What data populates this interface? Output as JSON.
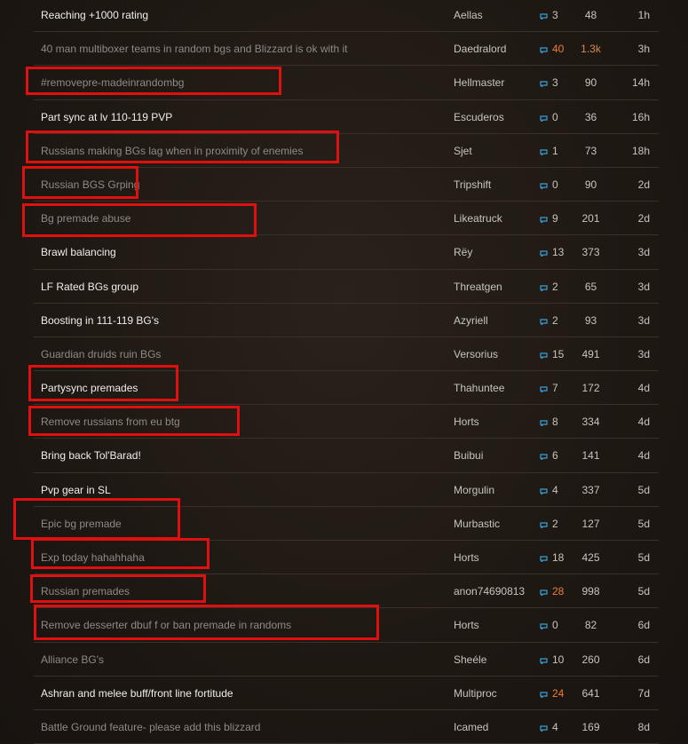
{
  "accent_colors": {
    "reply_icon": "#3aa0d8",
    "hot_count": "#ee7d32",
    "highlight": "#e01010"
  },
  "reply_icon_name": "comment-bubble-icon",
  "topics": [
    {
      "title": "Reaching +1000 rating",
      "author": "Aellas",
      "replies": "3",
      "views": "48",
      "age": "1h",
      "visited": false,
      "hot": false
    },
    {
      "title": "40 man multiboxer teams in random bgs and Blizzard is ok with it",
      "author": "Daedralord",
      "replies": "40",
      "views": "1.3k",
      "age": "3h",
      "visited": true,
      "hot": true
    },
    {
      "title": "#removepre-madeinrandombg",
      "author": "Hellmaster",
      "replies": "3",
      "views": "90",
      "age": "14h",
      "visited": true,
      "hot": false
    },
    {
      "title": "Part sync at lv 110-119 PVP",
      "author": "Escuderos",
      "replies": "0",
      "views": "36",
      "age": "16h",
      "visited": false,
      "hot": false
    },
    {
      "title": "Russians making BGs lag when in proximity of enemies",
      "author": "Sjet",
      "replies": "1",
      "views": "73",
      "age": "18h",
      "visited": true,
      "hot": false
    },
    {
      "title": "Russian BGS Grping",
      "author": "Tripshift",
      "replies": "0",
      "views": "90",
      "age": "2d",
      "visited": true,
      "hot": false
    },
    {
      "title": "Bg premade abuse",
      "author": "Likeatruck",
      "replies": "9",
      "views": "201",
      "age": "2d",
      "visited": true,
      "hot": false
    },
    {
      "title": "Brawl balancing",
      "author": "Rëy",
      "replies": "13",
      "views": "373",
      "age": "3d",
      "visited": false,
      "hot": false
    },
    {
      "title": "LF Rated BGs group",
      "author": "Threatgen",
      "replies": "2",
      "views": "65",
      "age": "3d",
      "visited": false,
      "hot": false
    },
    {
      "title": "Boosting in 111-119 BG's",
      "author": "Azyriell",
      "replies": "2",
      "views": "93",
      "age": "3d",
      "visited": false,
      "hot": false
    },
    {
      "title": "Guardian druids ruin BGs",
      "author": "Versorius",
      "replies": "15",
      "views": "491",
      "age": "3d",
      "visited": true,
      "hot": false
    },
    {
      "title": "Partysync premades",
      "author": "Thahuntee",
      "replies": "7",
      "views": "172",
      "age": "4d",
      "visited": false,
      "hot": false
    },
    {
      "title": "Remove russians from eu btg",
      "author": "Horts",
      "replies": "8",
      "views": "334",
      "age": "4d",
      "visited": true,
      "hot": false
    },
    {
      "title": "Bring back Tol'Barad!",
      "author": "Buibui",
      "replies": "6",
      "views": "141",
      "age": "4d",
      "visited": false,
      "hot": false
    },
    {
      "title": "Pvp gear in SL",
      "author": "Morgulin",
      "replies": "4",
      "views": "337",
      "age": "5d",
      "visited": false,
      "hot": false
    },
    {
      "title": "Epic bg premade",
      "author": "Murbastic",
      "replies": "2",
      "views": "127",
      "age": "5d",
      "visited": true,
      "hot": false
    },
    {
      "title": "Exp today hahahhaha",
      "author": "Horts",
      "replies": "18",
      "views": "425",
      "age": "5d",
      "visited": true,
      "hot": false
    },
    {
      "title": "Russian premades",
      "author": "anon74690813",
      "replies": "28",
      "views": "998",
      "age": "5d",
      "visited": true,
      "hot": true
    },
    {
      "title": "Remove desserter dbuf f or ban premade in randoms",
      "author": "Horts",
      "replies": "0",
      "views": "82",
      "age": "6d",
      "visited": true,
      "hot": false
    },
    {
      "title": "Alliance BG's",
      "author": "Sheéle",
      "replies": "10",
      "views": "260",
      "age": "6d",
      "visited": true,
      "hot": false
    },
    {
      "title": "Ashran and melee buff/front line fortitude",
      "author": "Multiproc",
      "replies": "24",
      "views": "641",
      "age": "7d",
      "visited": false,
      "hot": true
    },
    {
      "title": "Battle Ground feature- please add this blizzard",
      "author": "Icamed",
      "replies": "4",
      "views": "169",
      "age": "8d",
      "visited": true,
      "hot": false
    }
  ]
}
